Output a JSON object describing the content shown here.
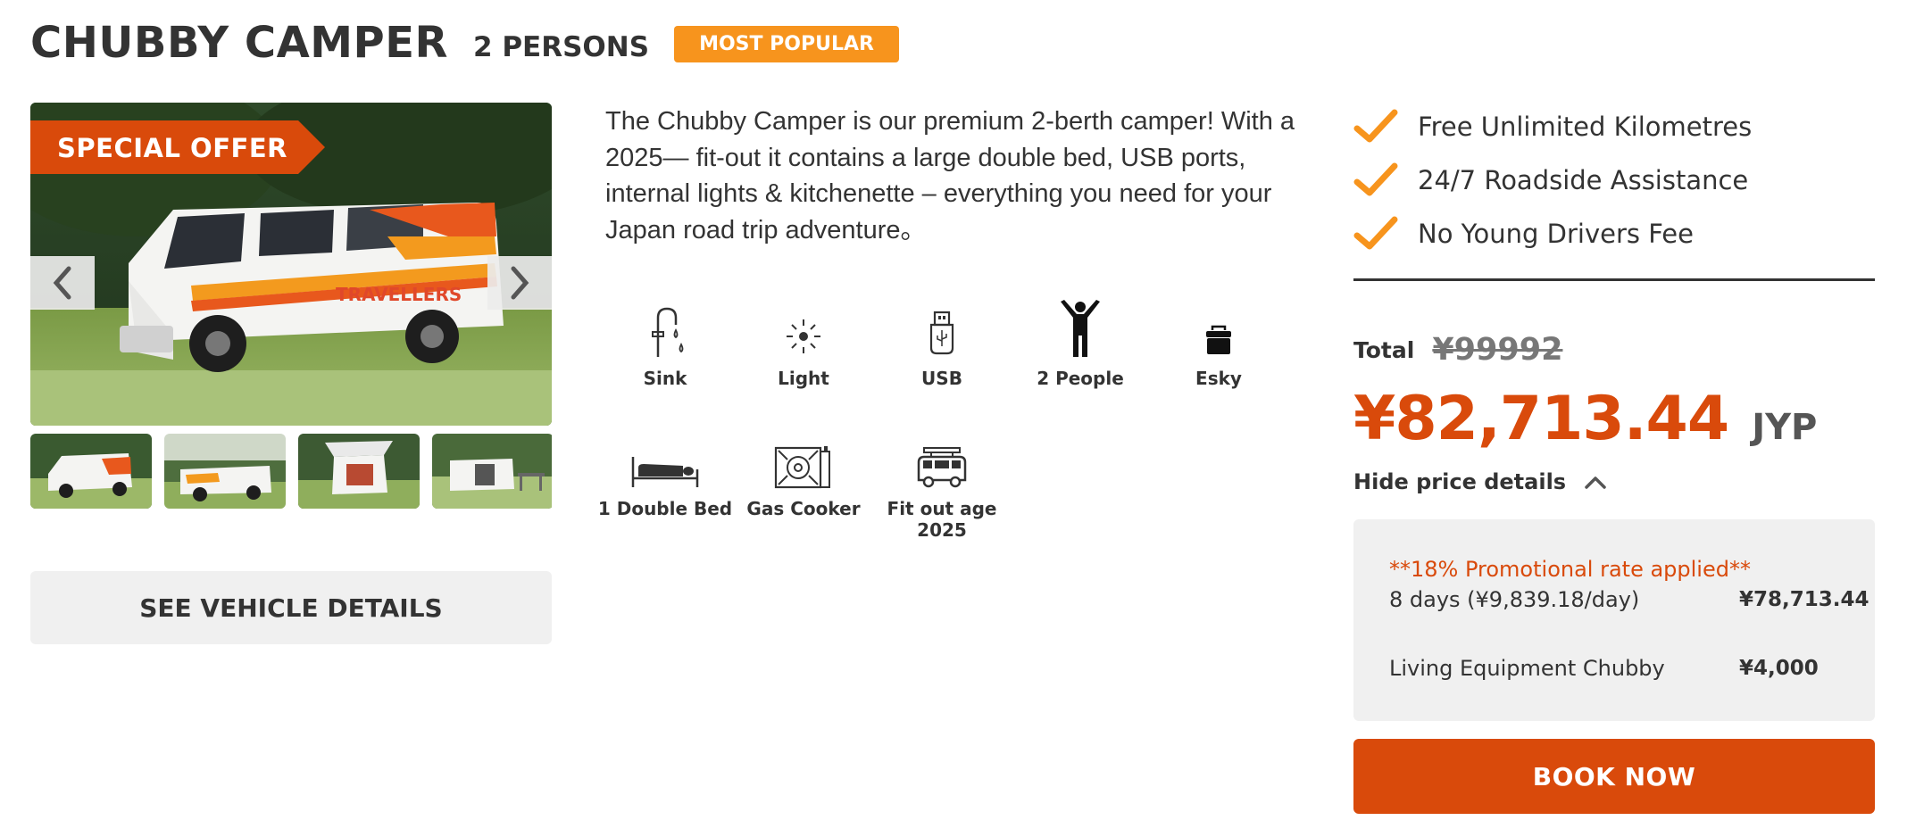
{
  "header": {
    "title": "CHUBBY CAMPER",
    "persons": "2 PERSONS",
    "badge": "MOST POPULAR"
  },
  "gallery": {
    "offer_label": "SPECIAL OFFER",
    "thumbnail_count": 4
  },
  "description": "The Chubby Camper is our premium 2-berth camper! With a 2025— fit-out it contains a large double bed, USB ports, internal lights & kitchenette – everything you need for your Japan road trip adventure。",
  "features": [
    {
      "icon": "sink-icon",
      "label": "Sink"
    },
    {
      "icon": "light-icon",
      "label": "Light"
    },
    {
      "icon": "usb-icon",
      "label": "USB"
    },
    {
      "icon": "people-icon",
      "label": "2 People"
    },
    {
      "icon": "esky-icon",
      "label": "Esky"
    },
    {
      "icon": "bed-icon",
      "label": "1 Double Bed"
    },
    {
      "icon": "gas-cooker-icon",
      "label": "Gas Cooker"
    },
    {
      "icon": "van-icon",
      "label": "Fit out age 2025"
    }
  ],
  "details_button": "SEE VEHICLE DETAILS",
  "perks": [
    "Free Unlimited Kilometres",
    "24/7 Roadside Assistance",
    "No Young Drivers Fee"
  ],
  "pricing": {
    "total_label": "Total",
    "old_price": "¥99992",
    "price": "¥82,713.44",
    "currency": "JYP",
    "hide_details": "Hide price details",
    "promo": "**18% Promotional rate applied**",
    "lines": [
      {
        "label": "8 days (¥9,839.18/day)",
        "value": "¥78,713.44"
      },
      {
        "label": "Living Equipment Chubby",
        "value": "¥4,000"
      }
    ]
  },
  "book_button": "BOOK NOW",
  "colors": {
    "accent": "#d94a0b",
    "badge": "#f7941d",
    "check": "#f7941d",
    "panel": "#f0f0f0"
  }
}
